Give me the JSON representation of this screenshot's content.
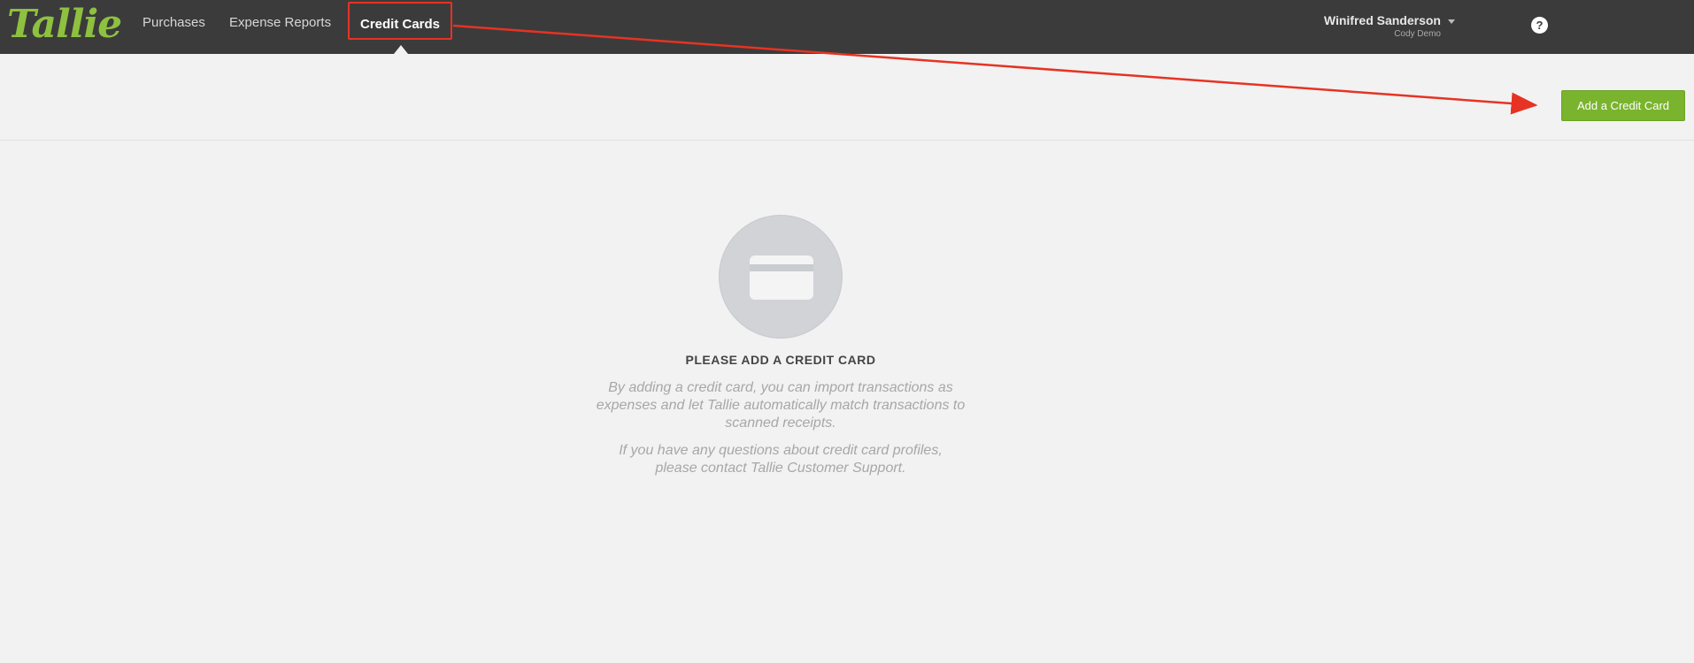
{
  "brand": {
    "logo_text": "Tallie",
    "logo_color": "#8dc13f"
  },
  "nav": {
    "items": [
      {
        "label": "Purchases"
      },
      {
        "label": "Expense Reports"
      },
      {
        "label": "Credit Cards",
        "active": true
      }
    ]
  },
  "user": {
    "name": "Winifred Sanderson",
    "subtitle": "Cody Demo"
  },
  "help": {
    "icon": "question-circle-icon",
    "glyph": "?"
  },
  "toolbar": {
    "add_button_label": "Add a Credit Card",
    "add_button_color": "#7ab42e"
  },
  "annotation": {
    "color": "#e63323"
  },
  "empty_state": {
    "icon": "credit-card-icon",
    "title": "PLEASE ADD A CREDIT CARD",
    "description_lines": [
      "By adding a credit card, you can import transactions as",
      "expenses and let Tallie automatically match transactions to",
      "scanned receipts."
    ],
    "support_lines": [
      "If you have any questions about credit card profiles,",
      "please contact Tallie Customer Support."
    ]
  }
}
